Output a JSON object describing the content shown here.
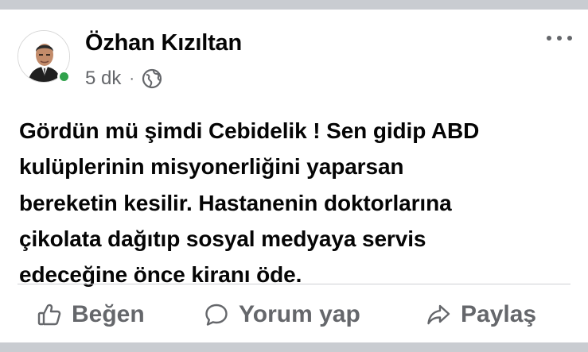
{
  "post": {
    "author": "Özhan Kızıltan",
    "time": "5 dk",
    "separator": "·",
    "audience_icon": "globe-icon",
    "online": true,
    "online_color": "#31a24c",
    "text_lines": [
      "Gördün mü şimdi Cebidelik ! Sen gidip ABD",
      "kulüplerinin misyonerliğini yaparsan",
      "bereketin kesilir. Hastanenin doktorlarına",
      "çikolata dağıtıp sosyal medyaya servis",
      "edeceğine önce kiranı öde."
    ]
  },
  "actions": {
    "like": {
      "label": "Beğen",
      "icon": "thumbs-up-icon"
    },
    "comment": {
      "label": "Yorum yap",
      "icon": "comment-icon"
    },
    "share": {
      "label": "Paylaş",
      "icon": "share-icon"
    }
  },
  "colors": {
    "background": "#c9ccd1",
    "card": "#ffffff",
    "text": "#050505",
    "secondary": "#65676b",
    "divider": "#ced0d4"
  }
}
